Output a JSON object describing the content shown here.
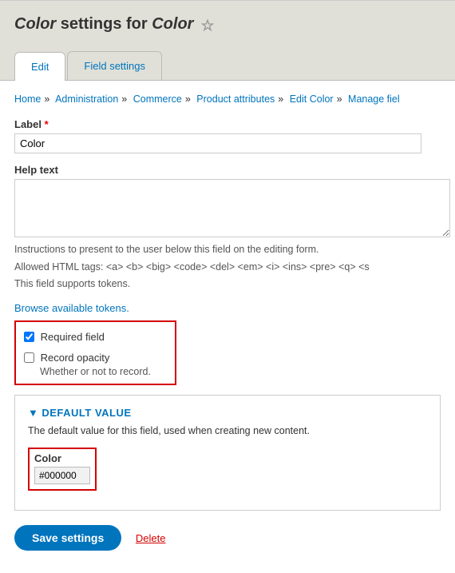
{
  "header": {
    "title_prefix": "Color",
    "title_mid": " settings for ",
    "title_suffix": "Color"
  },
  "tabs": {
    "edit": "Edit",
    "field_settings": "Field settings"
  },
  "breadcrumb": {
    "home": "Home",
    "admin": "Administration",
    "commerce": "Commerce",
    "product_attributes": "Product attributes",
    "edit_color": "Edit Color",
    "manage": "Manage fiel"
  },
  "label": {
    "label": "Label",
    "value": "Color"
  },
  "help_text": {
    "label": "Help text",
    "value": "",
    "desc1": "Instructions to present to the user below this field on the editing form.",
    "desc2": "Allowed HTML tags: <a> <b> <big> <code> <del> <em> <i> <ins> <pre> <q> <s",
    "desc3": "This field supports tokens."
  },
  "browse_tokens": "Browse available tokens.",
  "required_field": {
    "label": "Required field"
  },
  "record_opacity": {
    "label": "Record opacity",
    "desc": "Whether or not to record."
  },
  "default_value": {
    "legend": "Default Value",
    "desc": "The default value for this field, used when creating new content.",
    "color_label": "Color",
    "color_value": "#000000"
  },
  "actions": {
    "save": "Save settings",
    "delete": "Delete"
  }
}
